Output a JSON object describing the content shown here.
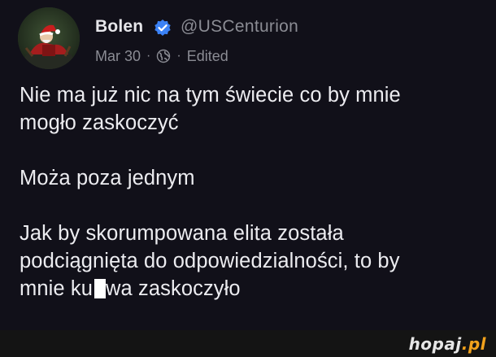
{
  "author": {
    "name": "Bolen",
    "handle": "@USCenturion",
    "verified_color": "#3b82f6"
  },
  "meta": {
    "date": "Mar 30",
    "separator": "·",
    "audience_icon": "globe-icon",
    "edited": "Edited"
  },
  "post": {
    "line1": "Nie ma już nic na tym świecie co by mnie",
    "line2": "mogło zaskoczyć",
    "line3": "Moża poza jednym",
    "line4": "Jak by skorumpowana elita została",
    "line5": "podciągnięta do odpowiedzialności, to by",
    "line6_start": "mnie ku",
    "line6_end": "wa zaskoczyło"
  },
  "watermark": {
    "site": "hopaj",
    "tld": ".pl",
    "tld_color": "#f2a21c"
  }
}
